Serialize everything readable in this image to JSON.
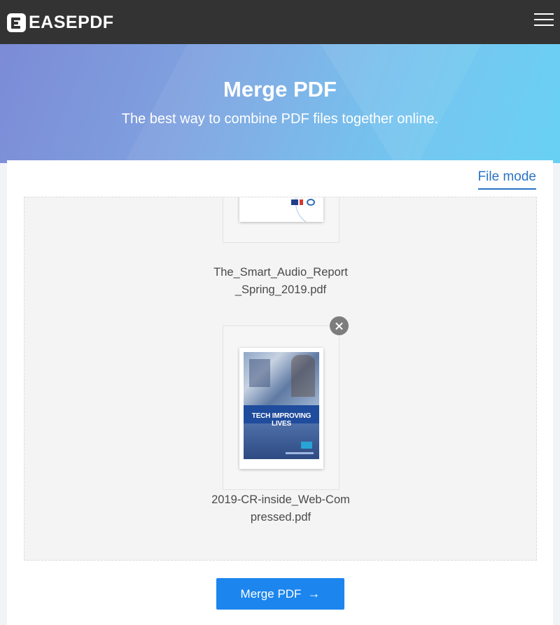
{
  "header": {
    "brand": "EASEPDF",
    "menu_icon": "hamburger-menu-icon"
  },
  "hero": {
    "title": "Merge PDF",
    "subtitle": "The best way to combine PDF files together online."
  },
  "panel": {
    "file_mode_label": "File mode"
  },
  "files": [
    {
      "name": "The_Smart_Audio_Report_Spring_2019.pdf",
      "thumbnail": "report-cover"
    },
    {
      "name": "2019-CR-inside_Web-Compressed.pdf",
      "thumbnail": "magazine-cover",
      "cover_headline": "TECH IMPROVING LIVES"
    }
  ],
  "actions": {
    "merge_label": "Merge PDF",
    "merge_icon": "arrow-right-icon"
  },
  "colors": {
    "topbar": "#333333",
    "accent": "#1c86ee",
    "link": "#2a73c4",
    "hero_start": "#7c8bd6",
    "hero_end": "#5ccdf2"
  }
}
